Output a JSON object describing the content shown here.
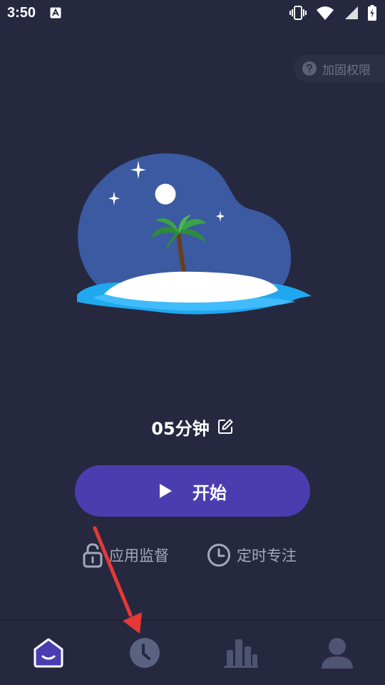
{
  "status_bar": {
    "time": "3:50"
  },
  "permission_chip": {
    "label": "加固权限"
  },
  "timer": {
    "duration_label": "05分钟"
  },
  "start_button": {
    "label": "开始"
  },
  "actions": {
    "app_monitor_label": "应用监督",
    "scheduled_focus_label": "定时专注"
  },
  "colors": {
    "background": "#262840",
    "accent": "#4b3db0",
    "annotation_arrow": "#e53935"
  },
  "icons": {
    "nav": [
      "home-icon",
      "clock-icon",
      "stats-icon",
      "profile-icon"
    ]
  }
}
